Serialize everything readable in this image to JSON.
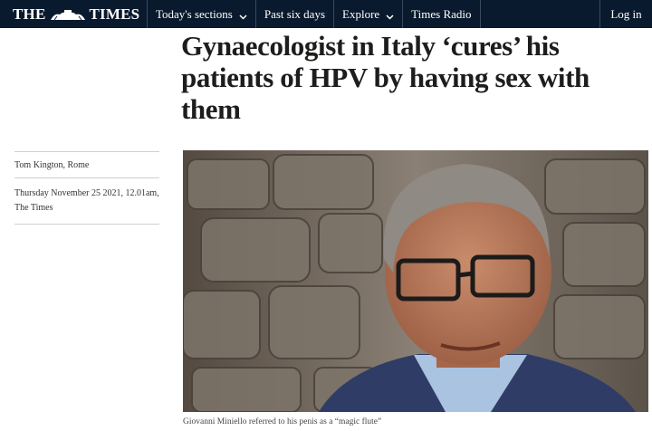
{
  "nav": {
    "logo_left": "THE",
    "logo_right": "TIMES",
    "items": [
      {
        "label": "Today's sections",
        "has_dropdown": true
      },
      {
        "label": "Past six days",
        "has_dropdown": false
      },
      {
        "label": "Explore",
        "has_dropdown": true
      },
      {
        "label": "Times Radio",
        "has_dropdown": false
      }
    ],
    "login_label": "Log in"
  },
  "article": {
    "headline": "Gynaecologist in Italy ‘cures’ his patients of HPV by having sex with them",
    "author": "Tom Kington, Rome",
    "date": "Thursday November 25 2021, 12.01am, The Times",
    "image_caption": "Giovanni Miniello referred to his penis as a “magic flute”"
  },
  "colors": {
    "nav_background": "#0a1a2e",
    "text": "#1d1d1b"
  },
  "icons": [
    "crest-icon",
    "chevron-down-icon"
  ]
}
